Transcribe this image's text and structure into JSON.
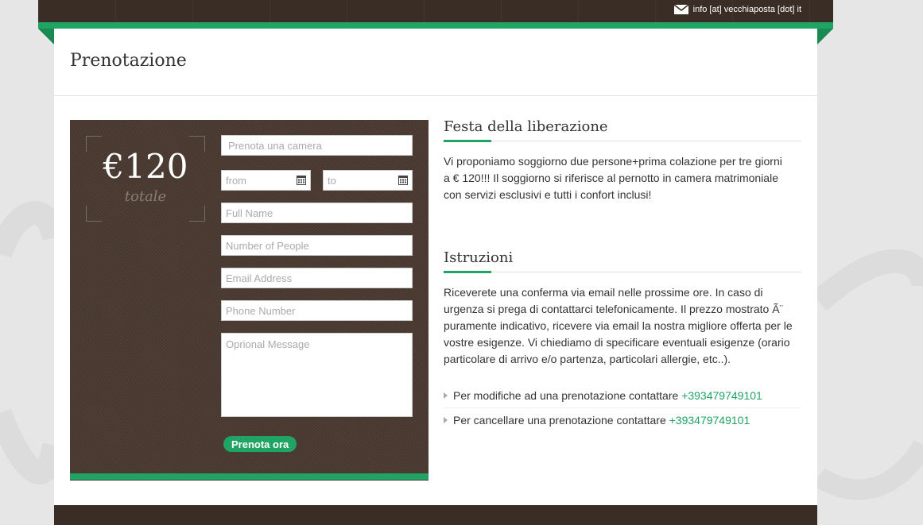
{
  "header": {
    "contact_email": "info [at] vecchiaposta [dot] it",
    "mail_icon": "envelope-icon"
  },
  "page": {
    "title": "Prenotazione"
  },
  "booking": {
    "price": "€120",
    "price_caption": "totale",
    "fields": {
      "room_placeholder": "Prenota una camera",
      "from_placeholder": "from",
      "to_placeholder": "to",
      "name_placeholder": "Full Name",
      "people_placeholder": "Number of People",
      "email_placeholder": "Email Address",
      "phone_placeholder": "Phone Number",
      "message_placeholder": "Oprional Message"
    },
    "submit_label": "Prenota ora",
    "calendar_icon": "calendar-icon"
  },
  "offer": {
    "title": "Festa della liberazione",
    "text": "Vi proponiamo soggiorno due persone+prima colazione per tre giorni a € 120!!! Il soggiorno si riferisce al pernotto in camera matrimoniale con servizi esclusivi e tutti i confort inclusi!"
  },
  "instructions": {
    "title": "Istruzioni",
    "text": "Riceverete una conferma via email nelle prossime ore. In caso di urgenza si prega di contattarci telefonicamente. Il prezzo mostrato Ã¨ puramente indicativo, ricevere via email la nostra migliore offerta per le vostre esigenze. Vi chiediamo di specificare eventuali esigenze (orario particolare di arrivo e/o partenza, particolari allergie, etc..).",
    "items": [
      {
        "label": "Per modifiche ad una prenotazione contattare",
        "phone": "+393479749101"
      },
      {
        "label": "Per cancellare una prenotazione contattare",
        "phone": "+393479749101"
      }
    ]
  },
  "colors": {
    "accent": "#20a463",
    "dark_brown": "#3a2d26",
    "booking_bg": "#4a3a32"
  }
}
